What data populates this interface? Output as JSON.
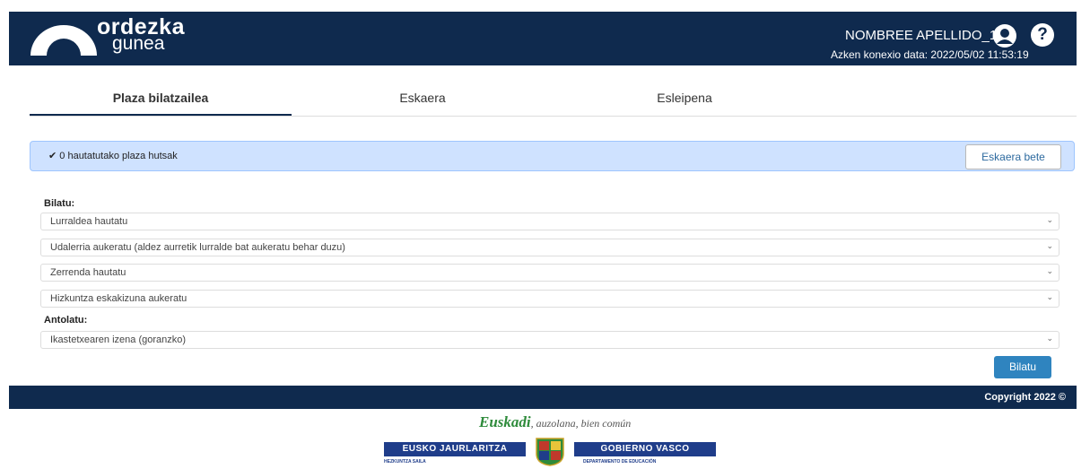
{
  "header": {
    "logo_line1": "ordezka",
    "logo_line2": "gunea",
    "user_name": "NOMBREE APELLIDO_1",
    "last_connection": "Azken konexio data: 2022/05/02 11:53:19",
    "help_glyph": "?"
  },
  "tabs": [
    {
      "label": "Plaza bilatzailea",
      "active": true
    },
    {
      "label": "Eskaera",
      "active": false
    },
    {
      "label": "Esleipena",
      "active": false
    }
  ],
  "alert": {
    "check": "✔",
    "text": "0 hautatutako plaza hutsak",
    "button": "Eskaera bete"
  },
  "search": {
    "label": "Bilatu:",
    "selects": [
      "Lurraldea hautatu",
      "Udalerria aukeratu (aldez aurretik lurralde bat aukeratu behar duzu)",
      "Zerrenda hautatu",
      "Hizkuntza eskakizuna aukeratu"
    ]
  },
  "sort": {
    "label": "Antolatu:",
    "select": "Ikastetxearen izena (goranzko)"
  },
  "search_button": "Bilatu",
  "footer": {
    "copyright": "Copyright 2022 ©"
  },
  "branding": {
    "slogan_main": "Euskadi",
    "slogan_rest": ", auzolana, bien común",
    "gov_left": "EUSKO JAURLARITZA",
    "gov_right": "GOBIERNO VASCO",
    "dept_left": "HEZKUNTZA SAILA",
    "dept_right": "DEPARTAMENTO DE EDUCACIÓN"
  },
  "colors": {
    "header_bg": "#0f2a4e",
    "alert_bg": "#cfe2ff",
    "button_blue": "#2f84bf",
    "gov_blue": "#1f3d8a"
  },
  "icons": [
    "user-icon",
    "help-icon",
    "check-icon",
    "chevron-down-icon"
  ]
}
